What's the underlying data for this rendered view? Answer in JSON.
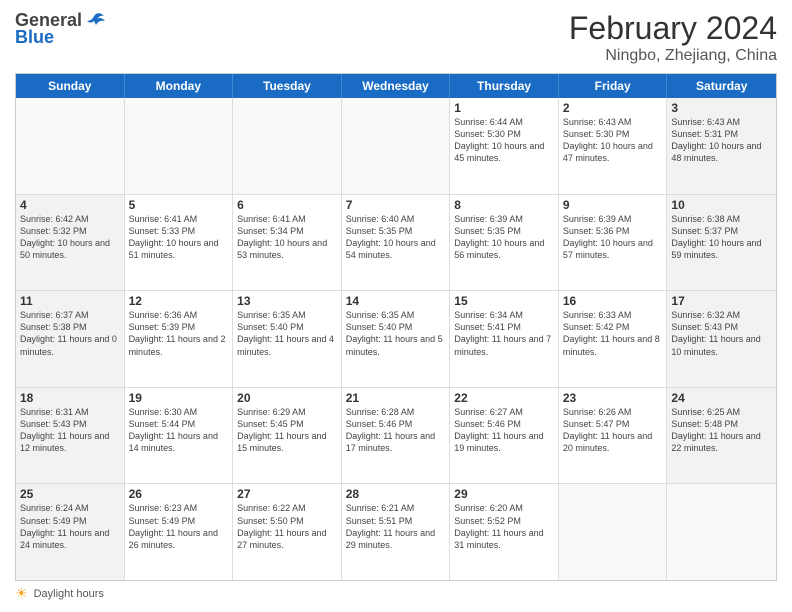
{
  "header": {
    "logo_general": "General",
    "logo_blue": "Blue",
    "title": "February 2024",
    "subtitle": "Ningbo, Zhejiang, China"
  },
  "calendar": {
    "days_of_week": [
      "Sunday",
      "Monday",
      "Tuesday",
      "Wednesday",
      "Thursday",
      "Friday",
      "Saturday"
    ],
    "weeks": [
      [
        {
          "day": "",
          "sunrise": "",
          "sunset": "",
          "daylight": "",
          "empty": true
        },
        {
          "day": "",
          "sunrise": "",
          "sunset": "",
          "daylight": "",
          "empty": true
        },
        {
          "day": "",
          "sunrise": "",
          "sunset": "",
          "daylight": "",
          "empty": true
        },
        {
          "day": "",
          "sunrise": "",
          "sunset": "",
          "daylight": "",
          "empty": true
        },
        {
          "day": "1",
          "sunrise": "Sunrise: 6:44 AM",
          "sunset": "Sunset: 5:30 PM",
          "daylight": "Daylight: 10 hours and 45 minutes.",
          "empty": false
        },
        {
          "day": "2",
          "sunrise": "Sunrise: 6:43 AM",
          "sunset": "Sunset: 5:30 PM",
          "daylight": "Daylight: 10 hours and 47 minutes.",
          "empty": false
        },
        {
          "day": "3",
          "sunrise": "Sunrise: 6:43 AM",
          "sunset": "Sunset: 5:31 PM",
          "daylight": "Daylight: 10 hours and 48 minutes.",
          "empty": false
        }
      ],
      [
        {
          "day": "4",
          "sunrise": "Sunrise: 6:42 AM",
          "sunset": "Sunset: 5:32 PM",
          "daylight": "Daylight: 10 hours and 50 minutes.",
          "empty": false
        },
        {
          "day": "5",
          "sunrise": "Sunrise: 6:41 AM",
          "sunset": "Sunset: 5:33 PM",
          "daylight": "Daylight: 10 hours and 51 minutes.",
          "empty": false
        },
        {
          "day": "6",
          "sunrise": "Sunrise: 6:41 AM",
          "sunset": "Sunset: 5:34 PM",
          "daylight": "Daylight: 10 hours and 53 minutes.",
          "empty": false
        },
        {
          "day": "7",
          "sunrise": "Sunrise: 6:40 AM",
          "sunset": "Sunset: 5:35 PM",
          "daylight": "Daylight: 10 hours and 54 minutes.",
          "empty": false
        },
        {
          "day": "8",
          "sunrise": "Sunrise: 6:39 AM",
          "sunset": "Sunset: 5:35 PM",
          "daylight": "Daylight: 10 hours and 56 minutes.",
          "empty": false
        },
        {
          "day": "9",
          "sunrise": "Sunrise: 6:39 AM",
          "sunset": "Sunset: 5:36 PM",
          "daylight": "Daylight: 10 hours and 57 minutes.",
          "empty": false
        },
        {
          "day": "10",
          "sunrise": "Sunrise: 6:38 AM",
          "sunset": "Sunset: 5:37 PM",
          "daylight": "Daylight: 10 hours and 59 minutes.",
          "empty": false
        }
      ],
      [
        {
          "day": "11",
          "sunrise": "Sunrise: 6:37 AM",
          "sunset": "Sunset: 5:38 PM",
          "daylight": "Daylight: 11 hours and 0 minutes.",
          "empty": false
        },
        {
          "day": "12",
          "sunrise": "Sunrise: 6:36 AM",
          "sunset": "Sunset: 5:39 PM",
          "daylight": "Daylight: 11 hours and 2 minutes.",
          "empty": false
        },
        {
          "day": "13",
          "sunrise": "Sunrise: 6:35 AM",
          "sunset": "Sunset: 5:40 PM",
          "daylight": "Daylight: 11 hours and 4 minutes.",
          "empty": false
        },
        {
          "day": "14",
          "sunrise": "Sunrise: 6:35 AM",
          "sunset": "Sunset: 5:40 PM",
          "daylight": "Daylight: 11 hours and 5 minutes.",
          "empty": false
        },
        {
          "day": "15",
          "sunrise": "Sunrise: 6:34 AM",
          "sunset": "Sunset: 5:41 PM",
          "daylight": "Daylight: 11 hours and 7 minutes.",
          "empty": false
        },
        {
          "day": "16",
          "sunrise": "Sunrise: 6:33 AM",
          "sunset": "Sunset: 5:42 PM",
          "daylight": "Daylight: 11 hours and 8 minutes.",
          "empty": false
        },
        {
          "day": "17",
          "sunrise": "Sunrise: 6:32 AM",
          "sunset": "Sunset: 5:43 PM",
          "daylight": "Daylight: 11 hours and 10 minutes.",
          "empty": false
        }
      ],
      [
        {
          "day": "18",
          "sunrise": "Sunrise: 6:31 AM",
          "sunset": "Sunset: 5:43 PM",
          "daylight": "Daylight: 11 hours and 12 minutes.",
          "empty": false
        },
        {
          "day": "19",
          "sunrise": "Sunrise: 6:30 AM",
          "sunset": "Sunset: 5:44 PM",
          "daylight": "Daylight: 11 hours and 14 minutes.",
          "empty": false
        },
        {
          "day": "20",
          "sunrise": "Sunrise: 6:29 AM",
          "sunset": "Sunset: 5:45 PM",
          "daylight": "Daylight: 11 hours and 15 minutes.",
          "empty": false
        },
        {
          "day": "21",
          "sunrise": "Sunrise: 6:28 AM",
          "sunset": "Sunset: 5:46 PM",
          "daylight": "Daylight: 11 hours and 17 minutes.",
          "empty": false
        },
        {
          "day": "22",
          "sunrise": "Sunrise: 6:27 AM",
          "sunset": "Sunset: 5:46 PM",
          "daylight": "Daylight: 11 hours and 19 minutes.",
          "empty": false
        },
        {
          "day": "23",
          "sunrise": "Sunrise: 6:26 AM",
          "sunset": "Sunset: 5:47 PM",
          "daylight": "Daylight: 11 hours and 20 minutes.",
          "empty": false
        },
        {
          "day": "24",
          "sunrise": "Sunrise: 6:25 AM",
          "sunset": "Sunset: 5:48 PM",
          "daylight": "Daylight: 11 hours and 22 minutes.",
          "empty": false
        }
      ],
      [
        {
          "day": "25",
          "sunrise": "Sunrise: 6:24 AM",
          "sunset": "Sunset: 5:49 PM",
          "daylight": "Daylight: 11 hours and 24 minutes.",
          "empty": false
        },
        {
          "day": "26",
          "sunrise": "Sunrise: 6:23 AM",
          "sunset": "Sunset: 5:49 PM",
          "daylight": "Daylight: 11 hours and 26 minutes.",
          "empty": false
        },
        {
          "day": "27",
          "sunrise": "Sunrise: 6:22 AM",
          "sunset": "Sunset: 5:50 PM",
          "daylight": "Daylight: 11 hours and 27 minutes.",
          "empty": false
        },
        {
          "day": "28",
          "sunrise": "Sunrise: 6:21 AM",
          "sunset": "Sunset: 5:51 PM",
          "daylight": "Daylight: 11 hours and 29 minutes.",
          "empty": false
        },
        {
          "day": "29",
          "sunrise": "Sunrise: 6:20 AM",
          "sunset": "Sunset: 5:52 PM",
          "daylight": "Daylight: 11 hours and 31 minutes.",
          "empty": false
        },
        {
          "day": "",
          "sunrise": "",
          "sunset": "",
          "daylight": "",
          "empty": true
        },
        {
          "day": "",
          "sunrise": "",
          "sunset": "",
          "daylight": "",
          "empty": true
        }
      ]
    ]
  },
  "footer": {
    "daylight_label": "Daylight hours"
  }
}
